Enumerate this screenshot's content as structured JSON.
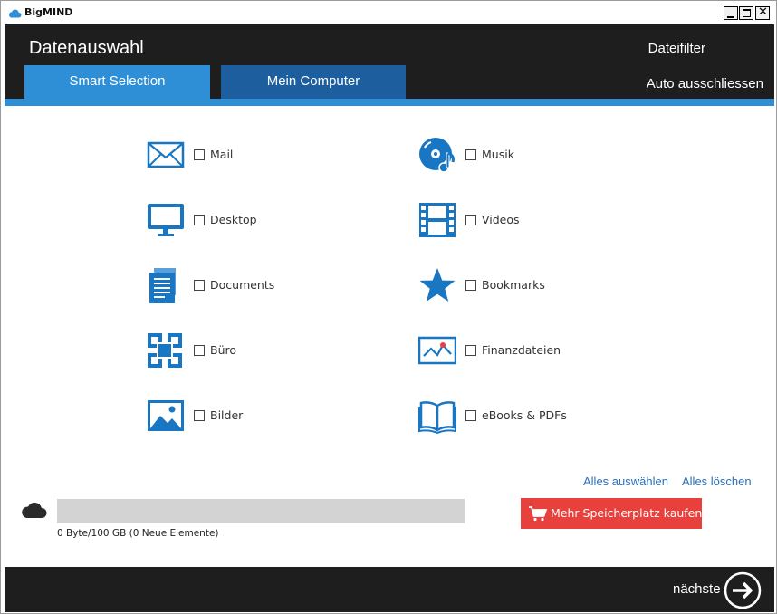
{
  "window": {
    "title": "BigMIND"
  },
  "header": {
    "title": "Datenauswahl",
    "file_filter": "Dateifilter",
    "auto_exclude": "Auto ausschliessen"
  },
  "tabs": [
    {
      "label": "Smart Selection",
      "active": true
    },
    {
      "label": "Mein Computer",
      "active": false
    }
  ],
  "categories": {
    "left": [
      {
        "label": "Mail",
        "icon": "envelope-icon",
        "checked": false
      },
      {
        "label": "Desktop",
        "icon": "monitor-icon",
        "checked": false
      },
      {
        "label": "Documents",
        "icon": "documents-icon",
        "checked": false
      },
      {
        "label": "Büro",
        "icon": "office-icon",
        "checked": false
      },
      {
        "label": "Bilder",
        "icon": "picture-icon",
        "checked": false
      }
    ],
    "right": [
      {
        "label": "Musik",
        "icon": "music-disc-icon",
        "checked": false
      },
      {
        "label": "Videos",
        "icon": "film-icon",
        "checked": false
      },
      {
        "label": "Bookmarks",
        "icon": "star-icon",
        "checked": false
      },
      {
        "label": "Finanzdateien",
        "icon": "chart-line-icon",
        "checked": false
      },
      {
        "label": "eBooks & PDFs",
        "icon": "open-book-icon",
        "checked": false
      }
    ]
  },
  "actions": {
    "select_all": "Alles auswählen",
    "clear_all": "Alles löschen"
  },
  "storage": {
    "text": "0 Byte/100 GB (0 Neue Elemente)",
    "used_fraction": 0
  },
  "buy": {
    "label": "Mehr Speicherplatz kaufen"
  },
  "footer": {
    "next_label": "nächste"
  },
  "colors": {
    "accent": "#2e8fd6",
    "dark": "#1e1e1e",
    "buy": "#e8403c",
    "link": "#2a6fbc"
  }
}
